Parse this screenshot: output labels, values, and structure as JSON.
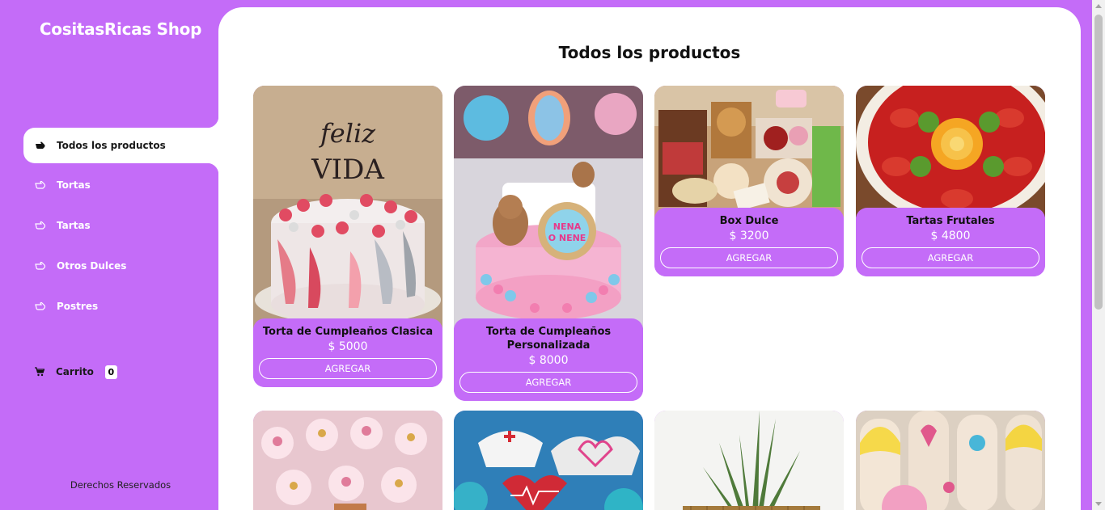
{
  "brand": "CositasRicas Shop",
  "nav": {
    "items": [
      {
        "label": "Todos los productos",
        "icon": "pointing-hand-icon"
      },
      {
        "label": "Tortas",
        "icon": "pointing-hand-icon"
      },
      {
        "label": "Tartas",
        "icon": "pointing-hand-icon"
      },
      {
        "label": "Otros Dulces",
        "icon": "pointing-hand-icon"
      },
      {
        "label": "Postres",
        "icon": "pointing-hand-icon"
      }
    ],
    "active": "Todos los productos"
  },
  "cart": {
    "label": "Carrito",
    "count": "0",
    "icon": "cart-icon"
  },
  "footer": "Derechos Reservados",
  "main": {
    "title": "Todos los productos"
  },
  "products": [
    {
      "name": "Torta de Cumpleaños Clasica",
      "price": "$ 5000",
      "button": "AGREGAR"
    },
    {
      "name": "Torta de Cumpleaños Personalizada",
      "price": "$ 8000",
      "button": "AGREGAR"
    },
    {
      "name": "Box Dulce",
      "price": "$ 3200",
      "button": "AGREGAR"
    },
    {
      "name": "Tartas Frutales",
      "price": "$ 4800",
      "button": "AGREGAR"
    }
  ],
  "colors": {
    "accent": "#c46cf8",
    "surface": "#ffffff"
  }
}
